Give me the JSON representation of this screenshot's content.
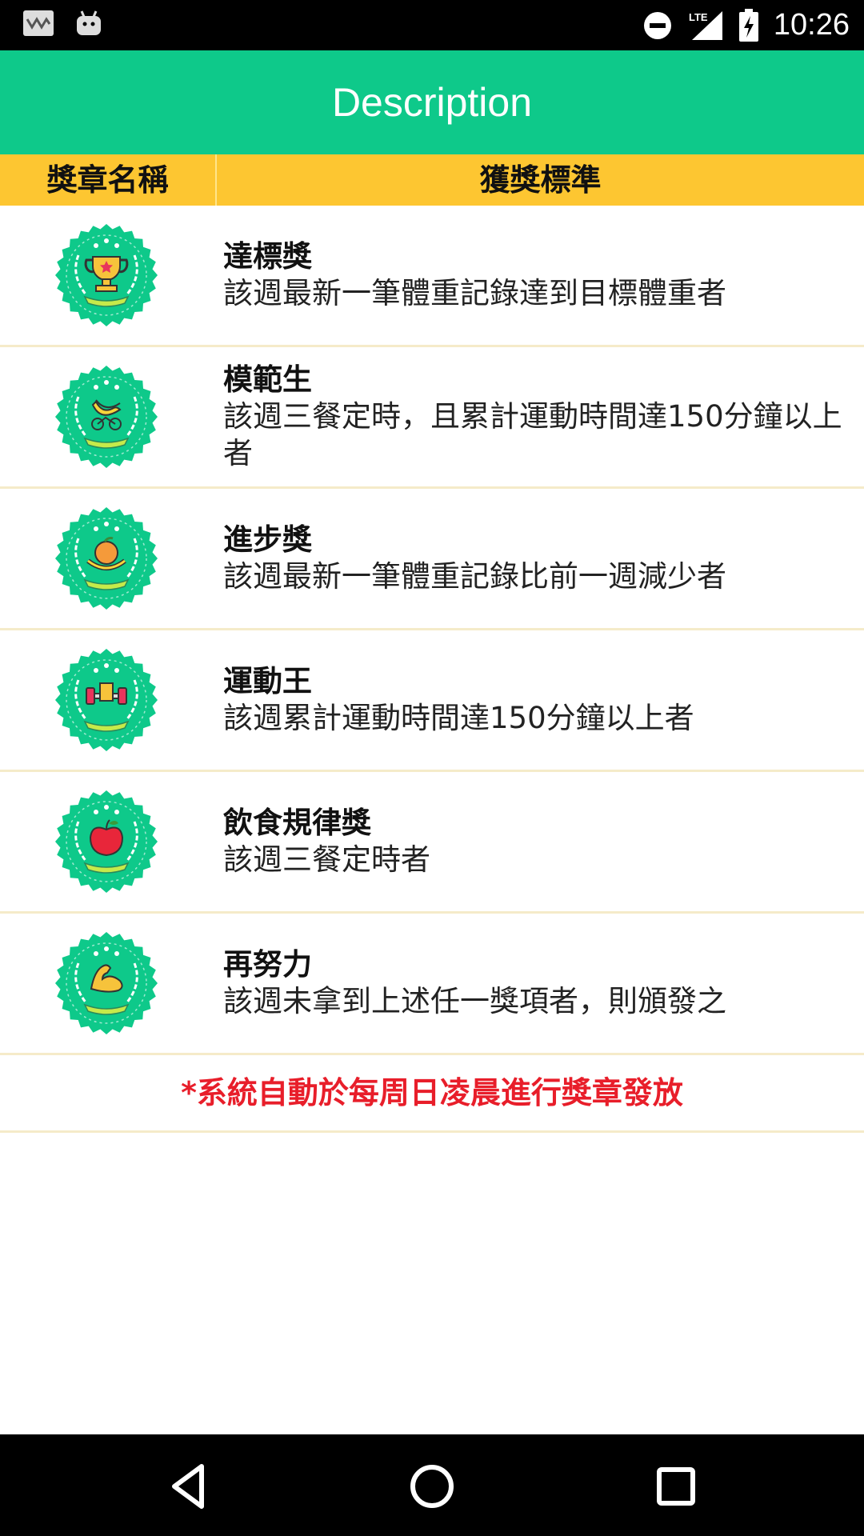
{
  "status_bar": {
    "time": "10:26",
    "network": "LTE",
    "icons": [
      "notification-icon",
      "android-icon",
      "do-not-disturb-icon",
      "signal-icon",
      "battery-charging-icon"
    ]
  },
  "app_bar": {
    "title": "Description"
  },
  "table_header": {
    "col_name": "獎章名稱",
    "col_criteria": "獲獎標準"
  },
  "badges": [
    {
      "title": "達標獎",
      "desc": "該週最新一筆體重記錄達到目標體重者",
      "icon": "trophy-icon"
    },
    {
      "title": "模範生",
      "desc": "該週三餐定時，且累計運動時間達150分鐘以上者",
      "icon": "banana-bike-icon"
    },
    {
      "title": "進步獎",
      "desc": "該週最新一筆體重記錄比前一週減少者",
      "icon": "orange-tape-icon"
    },
    {
      "title": "運動王",
      "desc": "該週累計運動時間達150分鐘以上者",
      "icon": "dumbbell-icon"
    },
    {
      "title": "飲食規律獎",
      "desc": "該週三餐定時者",
      "icon": "apple-icon"
    },
    {
      "title": "再努力",
      "desc": "該週未拿到上述任一獎項者，則頒發之",
      "icon": "muscle-arm-icon"
    }
  ],
  "footer_note": "*系統自動於每周日凌晨進行獎章發放",
  "colors": {
    "accent": "#0ec98a",
    "header": "#fdc631",
    "note": "#e81e2a"
  }
}
